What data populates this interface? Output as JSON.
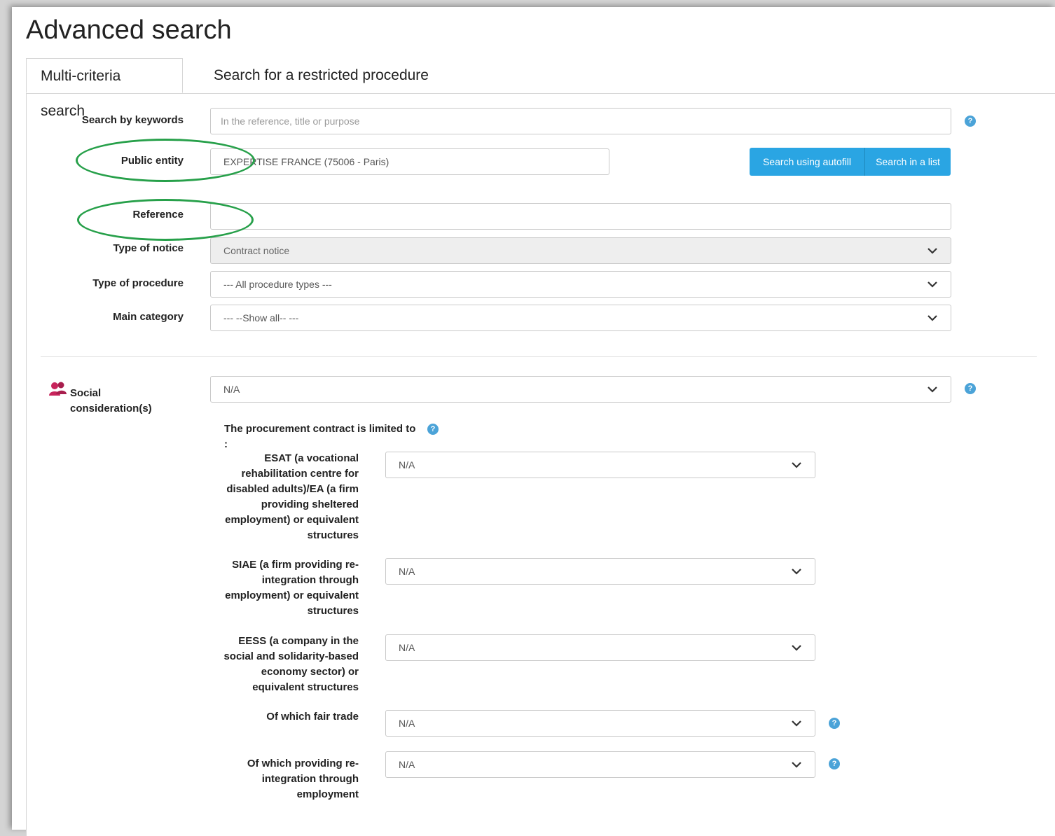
{
  "page": {
    "title": "Advanced search"
  },
  "tabs": [
    {
      "label": "Multi-criteria search",
      "active": true
    },
    {
      "label": "Search for a restricted procedure",
      "active": false
    }
  ],
  "form": {
    "keywords": {
      "label": "Search by keywords",
      "placeholder": "In the reference, title or purpose",
      "value": ""
    },
    "public_entity": {
      "label": "Public entity",
      "value": "EXPERTISE FRANCE (75006 - Paris)"
    },
    "buttons": {
      "autofill": "Search using autofill",
      "list": "Search in a list"
    },
    "reference": {
      "label": "Reference",
      "value": ""
    },
    "type_of_notice": {
      "label": "Type of notice",
      "value": "Contract notice"
    },
    "type_of_procedure": {
      "label": "Type of procedure",
      "value": "--- All procedure types ---"
    },
    "main_category": {
      "label": "Main category",
      "value": "--- --Show all-- ---"
    },
    "social": {
      "label": "Social consideration(s)",
      "value": "N/A"
    },
    "limited_to_label": "The procurement contract is limited to :",
    "limited": [
      {
        "label": "ESAT (a vocational rehabilitation centre for disabled adults)/EA (a firm providing sheltered employment) or equivalent structures",
        "value": "N/A"
      },
      {
        "label": "SIAE (a firm providing re-integration through employment) or equivalent structures",
        "value": "N/A"
      },
      {
        "label": "EESS (a company in the social and solidarity-based economy sector) or equivalent structures",
        "value": "N/A"
      },
      {
        "label": "Of which fair trade",
        "value": "N/A"
      },
      {
        "label": "Of which providing re-integration through employment",
        "value": "N/A"
      }
    ]
  },
  "icons": {
    "help": "help-circle-icon",
    "chevron": "chevron-down-icon",
    "social": "people-icon"
  },
  "colors": {
    "accent": "#2aa5e3",
    "help": "#4ba3d8",
    "annotation": "#27a04a",
    "social_icon": "#c8245c"
  }
}
